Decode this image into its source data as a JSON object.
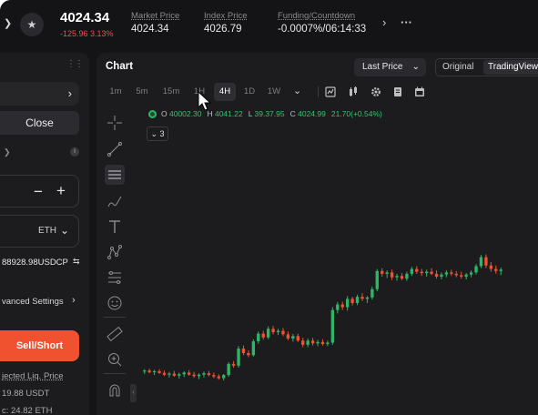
{
  "colors": {
    "up": "#2fb566",
    "down": "#f0522f",
    "accent": "#f0522f",
    "bg": "#141416",
    "panel": "#1c1c1f"
  },
  "ticker": {
    "price": "4024.34",
    "change": "-125.96 3.13%"
  },
  "stats": [
    {
      "label": "Market Price",
      "value": "4024.34"
    },
    {
      "label": "Index Price",
      "value": "4026.79"
    },
    {
      "label": "Funding/Countdown",
      "value": "-0.0007%/06:14:33"
    }
  ],
  "order_panel": {
    "close_label": "Close",
    "unit": "ETH",
    "available": "88928.98USDCP",
    "advanced_settings": "vanced Settings",
    "sell_short_label": "Sell/Short",
    "liq_label": "jected Liq. Price",
    "liq_value": "19.88  USDT",
    "margin_value": "c: 24.82 ETH"
  },
  "chart_panel": {
    "title": "Chart",
    "price_type": "Last Price",
    "view_original": "Original",
    "view_tradingview": "TradingView",
    "intervals": [
      "1m",
      "5m",
      "15m",
      "1H",
      "4H",
      "1D",
      "1W"
    ],
    "active_interval": "4H",
    "indicator_count": "3",
    "ohlc": {
      "o_key": "O",
      "o": "40002.30",
      "h_key": "H",
      "h": "4041.22",
      "l_key": "L",
      "l": "39.37.95",
      "c_key": "C",
      "c": "4024.99",
      "change": "21.70(+0.54%)"
    },
    "toolbar_icons": [
      "bar-style-icon",
      "candle-style-icon",
      "settings-icon",
      "document-icon",
      "calendar-icon"
    ],
    "draw_tools": [
      "crosshair-icon",
      "trend-line-icon",
      "horizontal-lines-icon",
      "brush-icon",
      "text-icon",
      "pattern-icon",
      "fib-icon",
      "emoji-icon",
      "ruler-icon",
      "zoom-in-icon",
      "magnet-icon"
    ]
  },
  "chart_data": {
    "type": "candlestick",
    "x_range": [
      0,
      80
    ],
    "y_range": [
      3450,
      4230
    ],
    "candles": [
      {
        "o": 3575,
        "h": 3582,
        "l": 3568,
        "c": 3578
      },
      {
        "o": 3578,
        "h": 3583,
        "l": 3570,
        "c": 3573
      },
      {
        "o": 3573,
        "h": 3580,
        "l": 3565,
        "c": 3576
      },
      {
        "o": 3576,
        "h": 3582,
        "l": 3568,
        "c": 3571
      },
      {
        "o": 3571,
        "h": 3578,
        "l": 3562,
        "c": 3566
      },
      {
        "o": 3566,
        "h": 3574,
        "l": 3558,
        "c": 3569
      },
      {
        "o": 3569,
        "h": 3577,
        "l": 3560,
        "c": 3563
      },
      {
        "o": 3563,
        "h": 3572,
        "l": 3555,
        "c": 3567
      },
      {
        "o": 3567,
        "h": 3576,
        "l": 3559,
        "c": 3572
      },
      {
        "o": 3572,
        "h": 3579,
        "l": 3563,
        "c": 3566
      },
      {
        "o": 3566,
        "h": 3574,
        "l": 3557,
        "c": 3562
      },
      {
        "o": 3562,
        "h": 3570,
        "l": 3553,
        "c": 3566
      },
      {
        "o": 3566,
        "h": 3575,
        "l": 3558,
        "c": 3570
      },
      {
        "o": 3570,
        "h": 3577,
        "l": 3561,
        "c": 3565
      },
      {
        "o": 3565,
        "h": 3572,
        "l": 3556,
        "c": 3561
      },
      {
        "o": 3561,
        "h": 3567,
        "l": 3552,
        "c": 3556
      },
      {
        "o": 3556,
        "h": 3568,
        "l": 3549,
        "c": 3565
      },
      {
        "o": 3565,
        "h": 3602,
        "l": 3560,
        "c": 3597
      },
      {
        "o": 3597,
        "h": 3605,
        "l": 3586,
        "c": 3592
      },
      {
        "o": 3592,
        "h": 3648,
        "l": 3586,
        "c": 3641
      },
      {
        "o": 3641,
        "h": 3650,
        "l": 3622,
        "c": 3628
      },
      {
        "o": 3628,
        "h": 3636,
        "l": 3616,
        "c": 3622
      },
      {
        "o": 3622,
        "h": 3668,
        "l": 3618,
        "c": 3662
      },
      {
        "o": 3662,
        "h": 3690,
        "l": 3655,
        "c": 3684
      },
      {
        "o": 3684,
        "h": 3692,
        "l": 3667,
        "c": 3673
      },
      {
        "o": 3673,
        "h": 3705,
        "l": 3668,
        "c": 3698
      },
      {
        "o": 3698,
        "h": 3706,
        "l": 3682,
        "c": 3688
      },
      {
        "o": 3688,
        "h": 3698,
        "l": 3680,
        "c": 3692
      },
      {
        "o": 3692,
        "h": 3700,
        "l": 3677,
        "c": 3682
      },
      {
        "o": 3682,
        "h": 3690,
        "l": 3665,
        "c": 3670
      },
      {
        "o": 3670,
        "h": 3683,
        "l": 3661,
        "c": 3677
      },
      {
        "o": 3677,
        "h": 3684,
        "l": 3660,
        "c": 3664
      },
      {
        "o": 3664,
        "h": 3672,
        "l": 3645,
        "c": 3652
      },
      {
        "o": 3652,
        "h": 3670,
        "l": 3645,
        "c": 3664
      },
      {
        "o": 3664,
        "h": 3672,
        "l": 3650,
        "c": 3656
      },
      {
        "o": 3656,
        "h": 3666,
        "l": 3648,
        "c": 3660
      },
      {
        "o": 3660,
        "h": 3668,
        "l": 3650,
        "c": 3654
      },
      {
        "o": 3654,
        "h": 3664,
        "l": 3648,
        "c": 3658
      },
      {
        "o": 3658,
        "h": 3760,
        "l": 3652,
        "c": 3752
      },
      {
        "o": 3752,
        "h": 3775,
        "l": 3742,
        "c": 3768
      },
      {
        "o": 3768,
        "h": 3776,
        "l": 3752,
        "c": 3760
      },
      {
        "o": 3760,
        "h": 3792,
        "l": 3750,
        "c": 3784
      },
      {
        "o": 3784,
        "h": 3790,
        "l": 3765,
        "c": 3772
      },
      {
        "o": 3772,
        "h": 3796,
        "l": 3766,
        "c": 3790
      },
      {
        "o": 3790,
        "h": 3800,
        "l": 3778,
        "c": 3784
      },
      {
        "o": 3784,
        "h": 3792,
        "l": 3772,
        "c": 3788
      },
      {
        "o": 3788,
        "h": 3820,
        "l": 3782,
        "c": 3812
      },
      {
        "o": 3812,
        "h": 3870,
        "l": 3806,
        "c": 3864
      },
      {
        "o": 3864,
        "h": 3872,
        "l": 3848,
        "c": 3856
      },
      {
        "o": 3856,
        "h": 3866,
        "l": 3844,
        "c": 3860
      },
      {
        "o": 3860,
        "h": 3868,
        "l": 3838,
        "c": 3846
      },
      {
        "o": 3846,
        "h": 3856,
        "l": 3836,
        "c": 3850
      },
      {
        "o": 3850,
        "h": 3858,
        "l": 3838,
        "c": 3842
      },
      {
        "o": 3842,
        "h": 3862,
        "l": 3836,
        "c": 3856
      },
      {
        "o": 3856,
        "h": 3876,
        "l": 3850,
        "c": 3870
      },
      {
        "o": 3870,
        "h": 3878,
        "l": 3856,
        "c": 3862
      },
      {
        "o": 3862,
        "h": 3870,
        "l": 3850,
        "c": 3858
      },
      {
        "o": 3858,
        "h": 3868,
        "l": 3848,
        "c": 3862
      },
      {
        "o": 3862,
        "h": 3872,
        "l": 3852,
        "c": 3856
      },
      {
        "o": 3856,
        "h": 3866,
        "l": 3842,
        "c": 3848
      },
      {
        "o": 3848,
        "h": 3860,
        "l": 3840,
        "c": 3854
      },
      {
        "o": 3854,
        "h": 3866,
        "l": 3846,
        "c": 3860
      },
      {
        "o": 3860,
        "h": 3868,
        "l": 3850,
        "c": 3856
      },
      {
        "o": 3856,
        "h": 3864,
        "l": 3846,
        "c": 3852
      },
      {
        "o": 3852,
        "h": 3862,
        "l": 3842,
        "c": 3848
      },
      {
        "o": 3848,
        "h": 3858,
        "l": 3840,
        "c": 3854
      },
      {
        "o": 3854,
        "h": 3866,
        "l": 3846,
        "c": 3860
      },
      {
        "o": 3860,
        "h": 3884,
        "l": 3854,
        "c": 3878
      },
      {
        "o": 3878,
        "h": 3910,
        "l": 3872,
        "c": 3904
      },
      {
        "o": 3904,
        "h": 3912,
        "l": 3872,
        "c": 3880
      },
      {
        "o": 3880,
        "h": 3890,
        "l": 3862,
        "c": 3870
      },
      {
        "o": 3870,
        "h": 3880,
        "l": 3856,
        "c": 3864
      },
      {
        "o": 3864,
        "h": 3874,
        "l": 3852,
        "c": 3868
      }
    ]
  }
}
